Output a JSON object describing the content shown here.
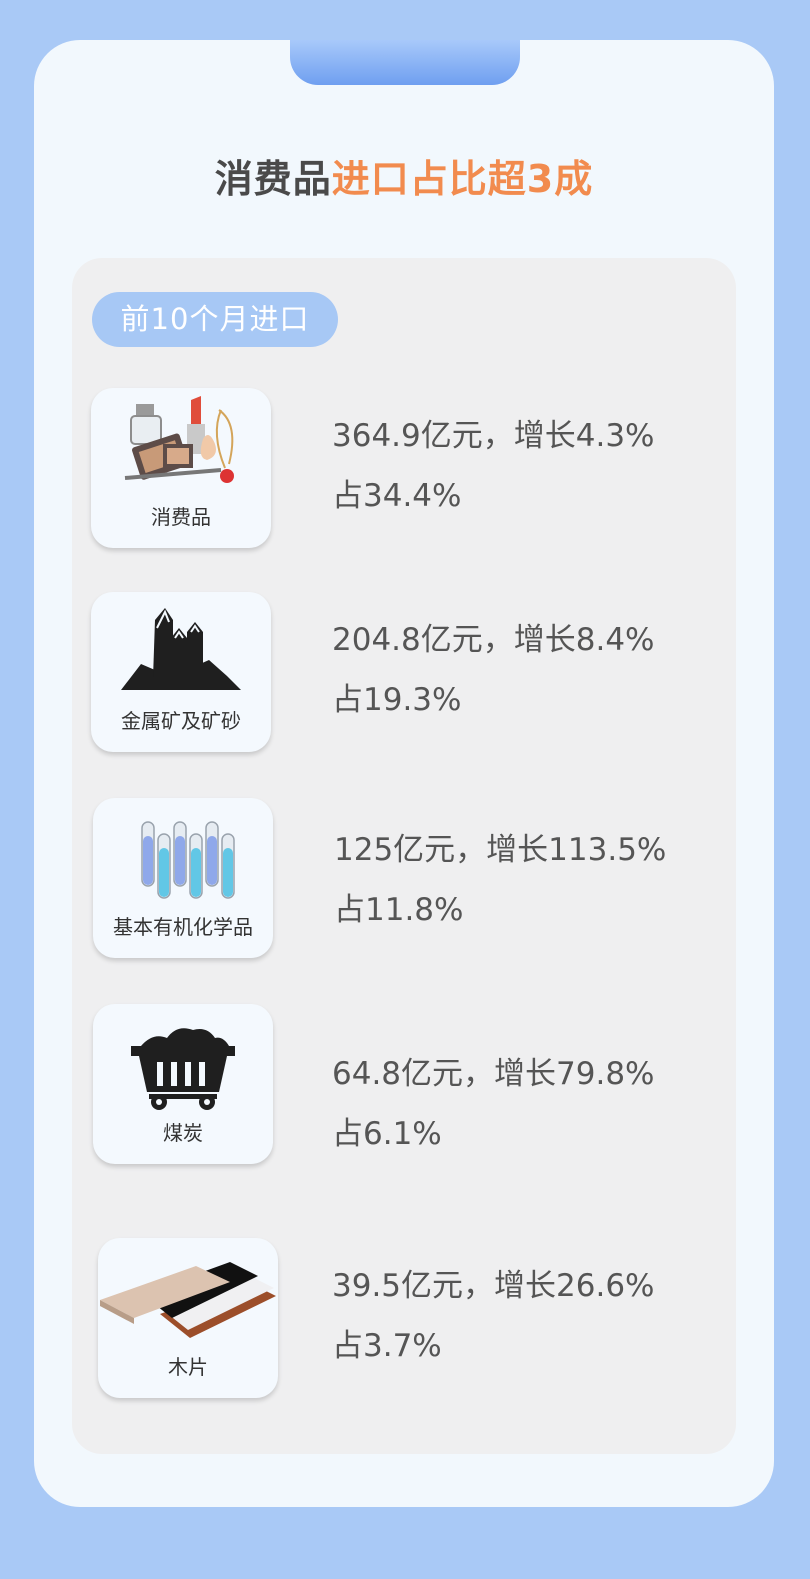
{
  "header": {
    "title_dark": "消费品",
    "title_accent": "进口占比超3成"
  },
  "section": {
    "tag": "前10个月进口"
  },
  "items": [
    {
      "label": "消费品",
      "amount_growth": "364.9亿元，增长4.3%",
      "share": "占34.4%",
      "icon": "cosmetics-icon"
    },
    {
      "label": "金属矿及矿砂",
      "amount_growth": "204.8亿元，增长8.4%",
      "share": "占19.3%",
      "icon": "ore-icon"
    },
    {
      "label": "基本有机化学品",
      "amount_growth": "125亿元，增长113.5%",
      "share": "占11.8%",
      "icon": "test-tubes-icon"
    },
    {
      "label": "煤炭",
      "amount_growth": "64.8亿元，增长79.8%",
      "share": "占6.1%",
      "icon": "coal-cart-icon"
    },
    {
      "label": "木片",
      "amount_growth": "39.5亿元，增长26.6%",
      "share": "占3.7%",
      "icon": "wood-boards-icon"
    }
  ],
  "colors": {
    "background": "#a9c9f6",
    "accent": "#f28b4e",
    "pill": "#a7c8f5"
  }
}
